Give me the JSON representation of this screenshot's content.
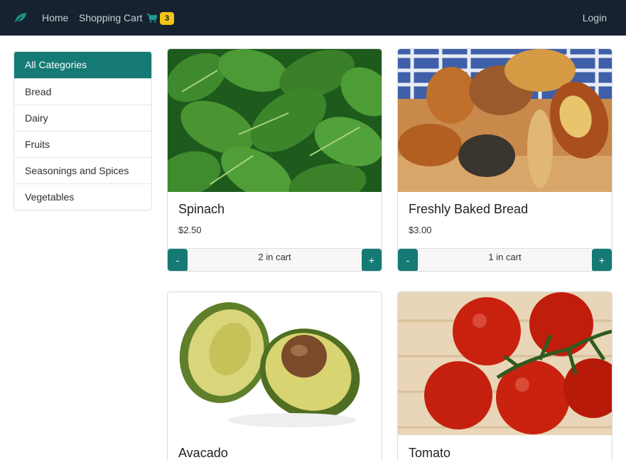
{
  "navbar": {
    "brand_icon": "leaf-icon",
    "home_label": "Home",
    "cart_label": "Shopping Cart",
    "cart_icon": "cart-icon",
    "cart_count": "3",
    "login_label": "Login"
  },
  "sidebar": {
    "items": [
      {
        "label": "All Categories",
        "active": true
      },
      {
        "label": "Bread"
      },
      {
        "label": "Dairy"
      },
      {
        "label": "Fruits"
      },
      {
        "label": "Seasonings and Spices"
      },
      {
        "label": "Vegetables"
      }
    ]
  },
  "products": [
    {
      "name": "Spinach",
      "price": "$2.50",
      "in_cart": "2 in cart",
      "minus": "-",
      "plus": "+"
    },
    {
      "name": "Freshly Baked Bread",
      "price": "$3.00",
      "in_cart": "1 in cart",
      "minus": "-",
      "plus": "+"
    },
    {
      "name": "Avacado"
    },
    {
      "name": "Tomato"
    }
  ],
  "colors": {
    "navbar_bg": "#16222f",
    "accent": "#157a74",
    "badge": "#f5c518"
  }
}
